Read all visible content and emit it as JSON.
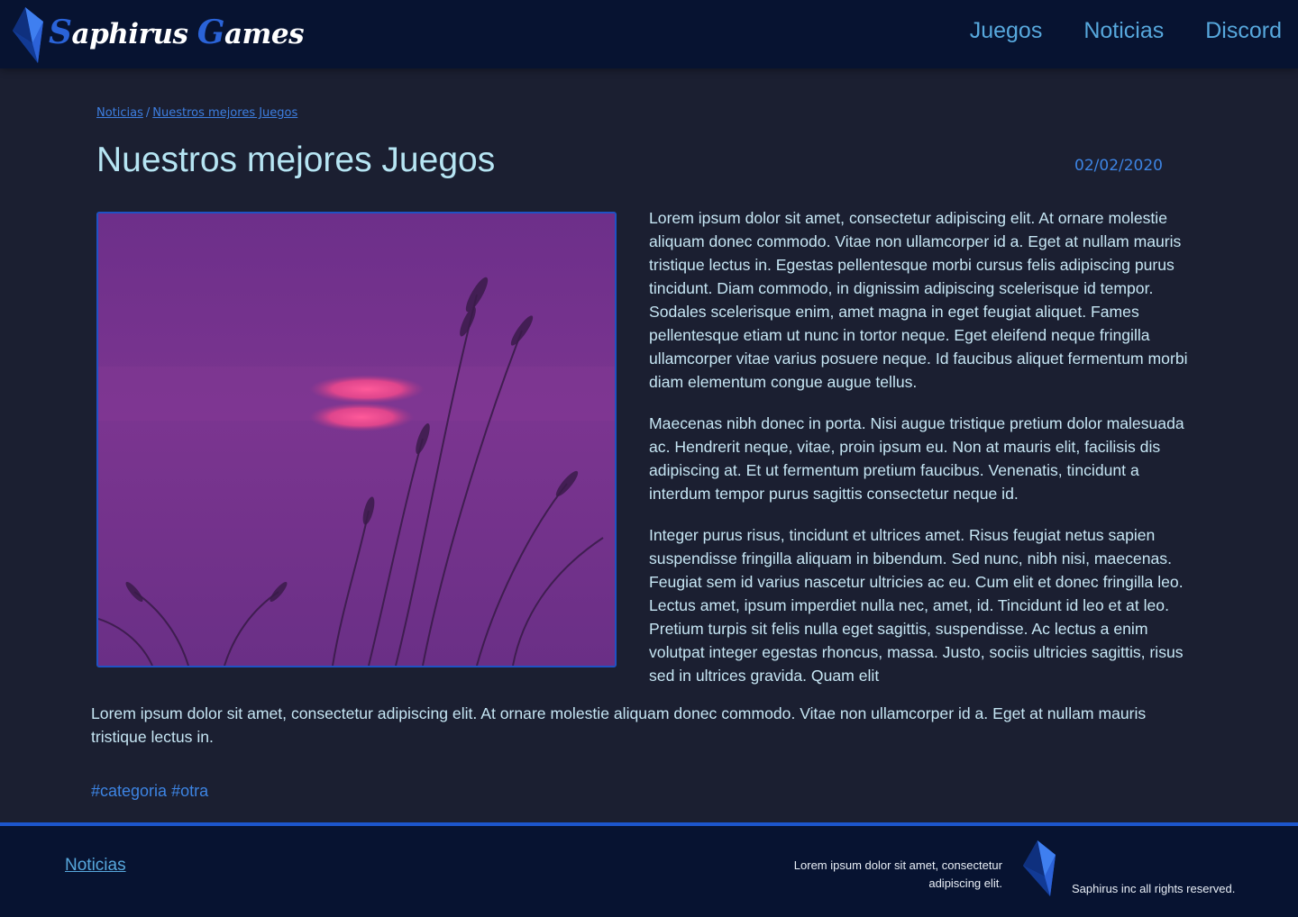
{
  "header": {
    "logo": {
      "cap1": "S",
      "rest1": "aphirus ",
      "cap2": "G",
      "rest2": "ames"
    },
    "nav": [
      "Juegos",
      "Noticias",
      "Discord"
    ]
  },
  "breadcrumb": {
    "items": [
      "Noticias",
      "Nuestros mejores Juegos"
    ],
    "separator": "/"
  },
  "article": {
    "title": "Nuestros mejores Juegos",
    "date": "02/02/2020",
    "image_icon": "sunset-grass-photo",
    "paragraphs": [
      "Lorem ipsum dolor sit amet, consectetur adipiscing elit. At ornare molestie aliquam donec commodo. Vitae non ullamcorper id a. Eget at nullam mauris tristique lectus in. Egestas pellentesque morbi cursus felis adipiscing purus tincidunt. Diam commodo, in dignissim adipiscing scelerisque id tempor. Sodales scelerisque enim, amet magna in eget feugiat aliquet. Fames pellentesque etiam ut nunc in tortor neque. Eget eleifend neque fringilla ullamcorper vitae varius posuere neque. Id faucibus aliquet fermentum morbi diam elementum congue augue tellus.",
      "Maecenas nibh donec in porta. Nisi augue tristique pretium dolor malesuada ac. Hendrerit neque, vitae, proin ipsum eu. Non at mauris elit, facilisis dis adipiscing at. Et ut fermentum pretium faucibus. Venenatis, tincidunt a interdum tempor purus sagittis consectetur neque id.",
      "Integer purus risus, tincidunt et ultrices amet. Risus feugiat netus sapien suspendisse fringilla aliquam in bibendum. Sed nunc, nibh nisi, maecenas. Feugiat sem id varius nascetur ultricies ac eu. Cum elit et donec fringilla leo. Lectus amet, ipsum imperdiet nulla nec, amet, id. Tincidunt id leo et at leo. Pretium turpis sit felis nulla eget sagittis, suspendisse. Ac lectus a enim volutpat integer egestas rhoncus, massa. Justo, sociis ultricies sagittis, risus sed in ultrices gravida. Quam elit"
    ],
    "full_width_paragraph": "Lorem ipsum dolor sit amet, consectetur adipiscing elit. At ornare molestie aliquam donec commodo. Vitae non ullamcorper id a. Eget at nullam mauris tristique lectus in.",
    "tags": [
      "#categoria",
      "#otra"
    ]
  },
  "footer": {
    "link": "Noticias",
    "text": "Lorem ipsum dolor sit amet, consectetur adipiscing elit.",
    "copyright": "Saphirus inc all rights reserved.",
    "logo_icon": "crystal-logo-icon"
  },
  "colors": {
    "background": "#1b1f31",
    "header": "#071331",
    "accent": "#1d56cc",
    "link": "#57a8dd",
    "text": "#c6e6f4"
  }
}
